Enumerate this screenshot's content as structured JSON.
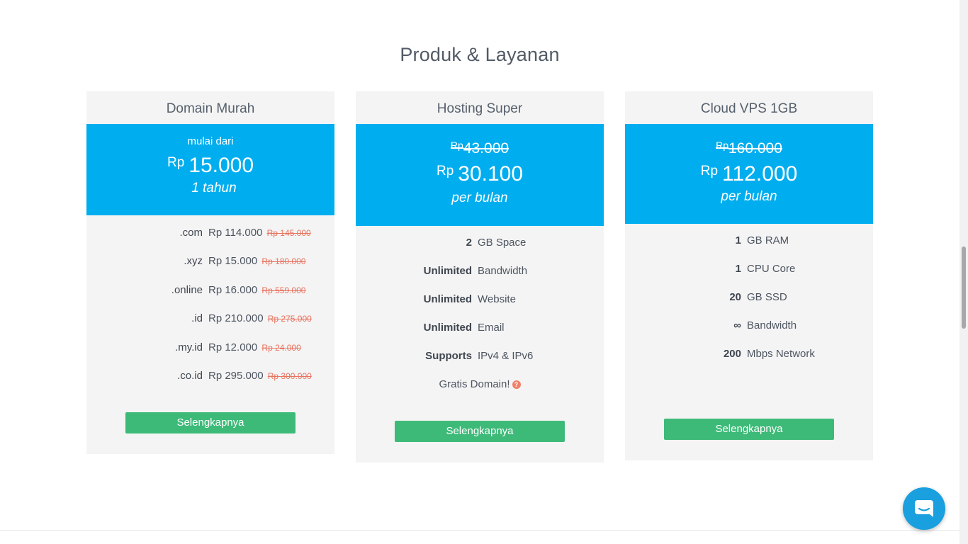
{
  "page": {
    "title": "Produk & Layanan"
  },
  "cards": [
    {
      "title": "Domain Murah",
      "start_text": "mulai dari",
      "currency": "Rp",
      "price": "15.000",
      "period": "1 tahun",
      "domains": [
        {
          "ext": ".com",
          "price": "Rp 114.000",
          "old": "Rp 145.000"
        },
        {
          "ext": ".xyz",
          "price": "Rp 15.000",
          "old": "Rp 180.000"
        },
        {
          "ext": ".online",
          "price": "Rp 16.000",
          "old": "Rp 559.000"
        },
        {
          "ext": ".id",
          "price": "Rp 210.000",
          "old": "Rp 275.000"
        },
        {
          "ext": ".my.id",
          "price": "Rp 12.000",
          "old": "Rp 24.000"
        },
        {
          "ext": ".co.id",
          "price": "Rp 295.000",
          "old": "Rp 300.000"
        }
      ],
      "button": "Selengkapnya"
    },
    {
      "title": "Hosting Super",
      "old_currency": "Rp",
      "old_price": "43.000",
      "currency": "Rp",
      "price": "30.100",
      "period": "per bulan",
      "features": [
        {
          "k": "2",
          "v": "GB Space"
        },
        {
          "k": "Unlimited",
          "v": "Bandwidth"
        },
        {
          "k": "Unlimited",
          "v": "Website"
        },
        {
          "k": "Unlimited",
          "v": "Email"
        },
        {
          "k": "Supports",
          "v": "IPv4 & IPv6"
        }
      ],
      "extra": "Gratis Domain!",
      "extra_icon": "question-circle-icon",
      "button": "Selengkapnya"
    },
    {
      "title": "Cloud VPS 1GB",
      "old_currency": "Rp",
      "old_price": "160.000",
      "currency": "Rp",
      "price": "112.000",
      "period": "per bulan",
      "features": [
        {
          "k": "1",
          "v": "GB RAM"
        },
        {
          "k": "1",
          "v": "CPU Core"
        },
        {
          "k": "20",
          "v": "GB SSD"
        },
        {
          "k": "∞",
          "v": "Bandwidth"
        },
        {
          "k": "200",
          "v": "Mbps Network"
        }
      ],
      "button": "Selengkapnya"
    }
  ],
  "chat": {
    "icon": "chat-bubble-icon"
  },
  "colors": {
    "accent": "#00aeef",
    "button": "#3dba78",
    "card_bg": "#f4f4f4",
    "strike": "#e8735f",
    "chat": "#1a9fdf"
  }
}
